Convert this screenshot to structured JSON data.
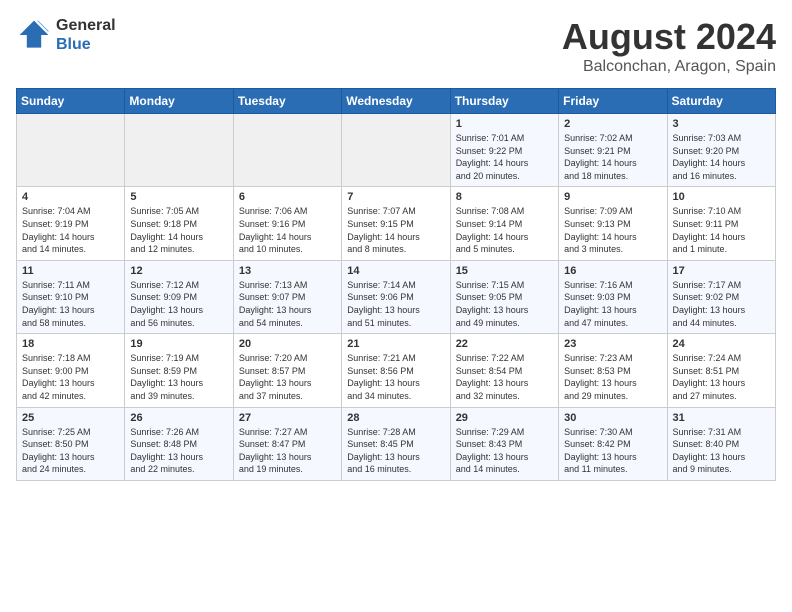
{
  "header": {
    "logo_general": "General",
    "logo_blue": "Blue",
    "title": "August 2024",
    "location": "Balconchan, Aragon, Spain"
  },
  "days_of_week": [
    "Sunday",
    "Monday",
    "Tuesday",
    "Wednesday",
    "Thursday",
    "Friday",
    "Saturday"
  ],
  "weeks": [
    [
      {
        "day": "",
        "info": ""
      },
      {
        "day": "",
        "info": ""
      },
      {
        "day": "",
        "info": ""
      },
      {
        "day": "",
        "info": ""
      },
      {
        "day": "1",
        "info": "Sunrise: 7:01 AM\nSunset: 9:22 PM\nDaylight: 14 hours\nand 20 minutes."
      },
      {
        "day": "2",
        "info": "Sunrise: 7:02 AM\nSunset: 9:21 PM\nDaylight: 14 hours\nand 18 minutes."
      },
      {
        "day": "3",
        "info": "Sunrise: 7:03 AM\nSunset: 9:20 PM\nDaylight: 14 hours\nand 16 minutes."
      }
    ],
    [
      {
        "day": "4",
        "info": "Sunrise: 7:04 AM\nSunset: 9:19 PM\nDaylight: 14 hours\nand 14 minutes."
      },
      {
        "day": "5",
        "info": "Sunrise: 7:05 AM\nSunset: 9:18 PM\nDaylight: 14 hours\nand 12 minutes."
      },
      {
        "day": "6",
        "info": "Sunrise: 7:06 AM\nSunset: 9:16 PM\nDaylight: 14 hours\nand 10 minutes."
      },
      {
        "day": "7",
        "info": "Sunrise: 7:07 AM\nSunset: 9:15 PM\nDaylight: 14 hours\nand 8 minutes."
      },
      {
        "day": "8",
        "info": "Sunrise: 7:08 AM\nSunset: 9:14 PM\nDaylight: 14 hours\nand 5 minutes."
      },
      {
        "day": "9",
        "info": "Sunrise: 7:09 AM\nSunset: 9:13 PM\nDaylight: 14 hours\nand 3 minutes."
      },
      {
        "day": "10",
        "info": "Sunrise: 7:10 AM\nSunset: 9:11 PM\nDaylight: 14 hours\nand 1 minute."
      }
    ],
    [
      {
        "day": "11",
        "info": "Sunrise: 7:11 AM\nSunset: 9:10 PM\nDaylight: 13 hours\nand 58 minutes."
      },
      {
        "day": "12",
        "info": "Sunrise: 7:12 AM\nSunset: 9:09 PM\nDaylight: 13 hours\nand 56 minutes."
      },
      {
        "day": "13",
        "info": "Sunrise: 7:13 AM\nSunset: 9:07 PM\nDaylight: 13 hours\nand 54 minutes."
      },
      {
        "day": "14",
        "info": "Sunrise: 7:14 AM\nSunset: 9:06 PM\nDaylight: 13 hours\nand 51 minutes."
      },
      {
        "day": "15",
        "info": "Sunrise: 7:15 AM\nSunset: 9:05 PM\nDaylight: 13 hours\nand 49 minutes."
      },
      {
        "day": "16",
        "info": "Sunrise: 7:16 AM\nSunset: 9:03 PM\nDaylight: 13 hours\nand 47 minutes."
      },
      {
        "day": "17",
        "info": "Sunrise: 7:17 AM\nSunset: 9:02 PM\nDaylight: 13 hours\nand 44 minutes."
      }
    ],
    [
      {
        "day": "18",
        "info": "Sunrise: 7:18 AM\nSunset: 9:00 PM\nDaylight: 13 hours\nand 42 minutes."
      },
      {
        "day": "19",
        "info": "Sunrise: 7:19 AM\nSunset: 8:59 PM\nDaylight: 13 hours\nand 39 minutes."
      },
      {
        "day": "20",
        "info": "Sunrise: 7:20 AM\nSunset: 8:57 PM\nDaylight: 13 hours\nand 37 minutes."
      },
      {
        "day": "21",
        "info": "Sunrise: 7:21 AM\nSunset: 8:56 PM\nDaylight: 13 hours\nand 34 minutes."
      },
      {
        "day": "22",
        "info": "Sunrise: 7:22 AM\nSunset: 8:54 PM\nDaylight: 13 hours\nand 32 minutes."
      },
      {
        "day": "23",
        "info": "Sunrise: 7:23 AM\nSunset: 8:53 PM\nDaylight: 13 hours\nand 29 minutes."
      },
      {
        "day": "24",
        "info": "Sunrise: 7:24 AM\nSunset: 8:51 PM\nDaylight: 13 hours\nand 27 minutes."
      }
    ],
    [
      {
        "day": "25",
        "info": "Sunrise: 7:25 AM\nSunset: 8:50 PM\nDaylight: 13 hours\nand 24 minutes."
      },
      {
        "day": "26",
        "info": "Sunrise: 7:26 AM\nSunset: 8:48 PM\nDaylight: 13 hours\nand 22 minutes."
      },
      {
        "day": "27",
        "info": "Sunrise: 7:27 AM\nSunset: 8:47 PM\nDaylight: 13 hours\nand 19 minutes."
      },
      {
        "day": "28",
        "info": "Sunrise: 7:28 AM\nSunset: 8:45 PM\nDaylight: 13 hours\nand 16 minutes."
      },
      {
        "day": "29",
        "info": "Sunrise: 7:29 AM\nSunset: 8:43 PM\nDaylight: 13 hours\nand 14 minutes."
      },
      {
        "day": "30",
        "info": "Sunrise: 7:30 AM\nSunset: 8:42 PM\nDaylight: 13 hours\nand 11 minutes."
      },
      {
        "day": "31",
        "info": "Sunrise: 7:31 AM\nSunset: 8:40 PM\nDaylight: 13 hours\nand 9 minutes."
      }
    ]
  ]
}
